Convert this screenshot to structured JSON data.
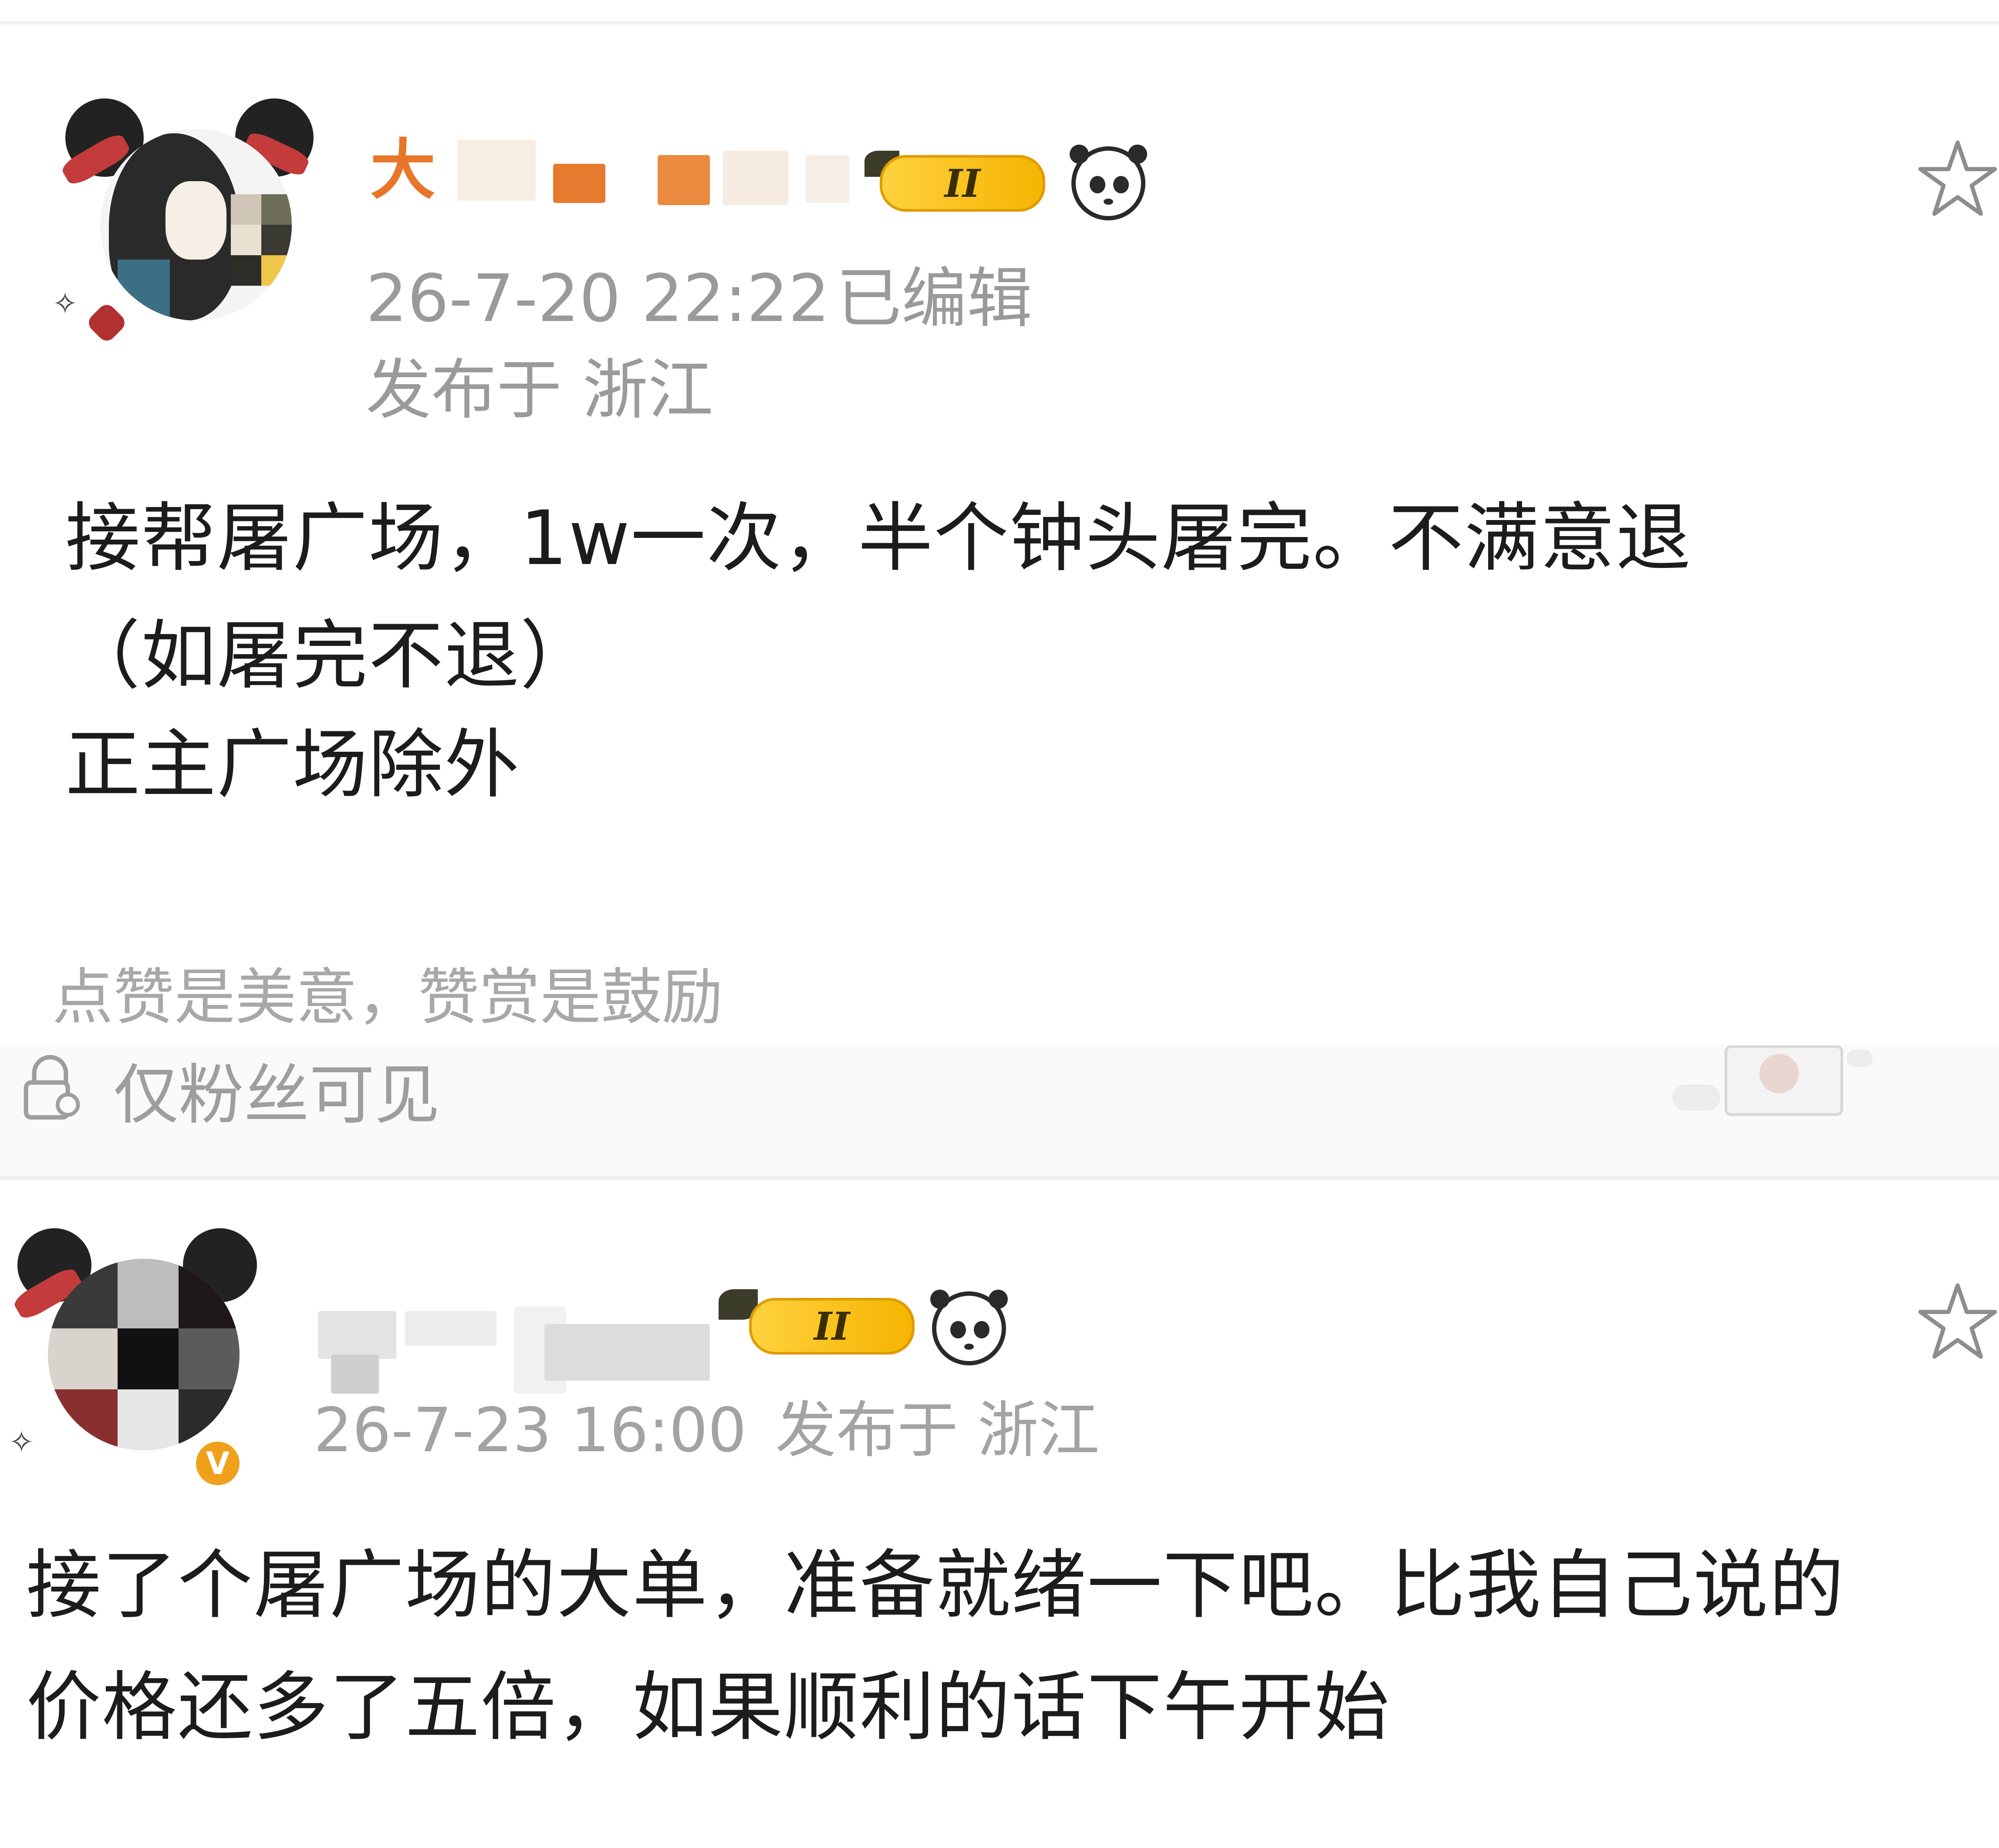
{
  "post1": {
    "username_visible": "大",
    "level_badge": "II",
    "timestamp": "26-7-20 22:22",
    "edited_label": "已编辑",
    "location": "发布于 浙江",
    "body_lines": [
      "接帮屠广场，1w一次，半个钟头屠完。不满意退",
      "（如屠完不退）",
      "正主广场除外"
    ],
    "reward_prompt": "点赞是美意，赞赏是鼓励",
    "visibility": "仅粉丝可见"
  },
  "post2": {
    "level_badge": "II",
    "verified_badge": "V",
    "timestamp": "26-7-23 16:00",
    "location": "发布于 浙江",
    "body_lines": [
      "接了个屠广场的大单，准备就绪一下吧。比我自己说的",
      "价格还多了五倍，如果顺利的话下午开始"
    ]
  },
  "icons": {
    "favorite": "star-outline-icon",
    "lock": "lock-person-icon",
    "panda": "panda-icon",
    "sparkle": "✧"
  },
  "colors": {
    "username": "#e8762a",
    "meta": "#9a9a9a",
    "level_badge": "#f5b400",
    "verified": "#f0a11c"
  }
}
